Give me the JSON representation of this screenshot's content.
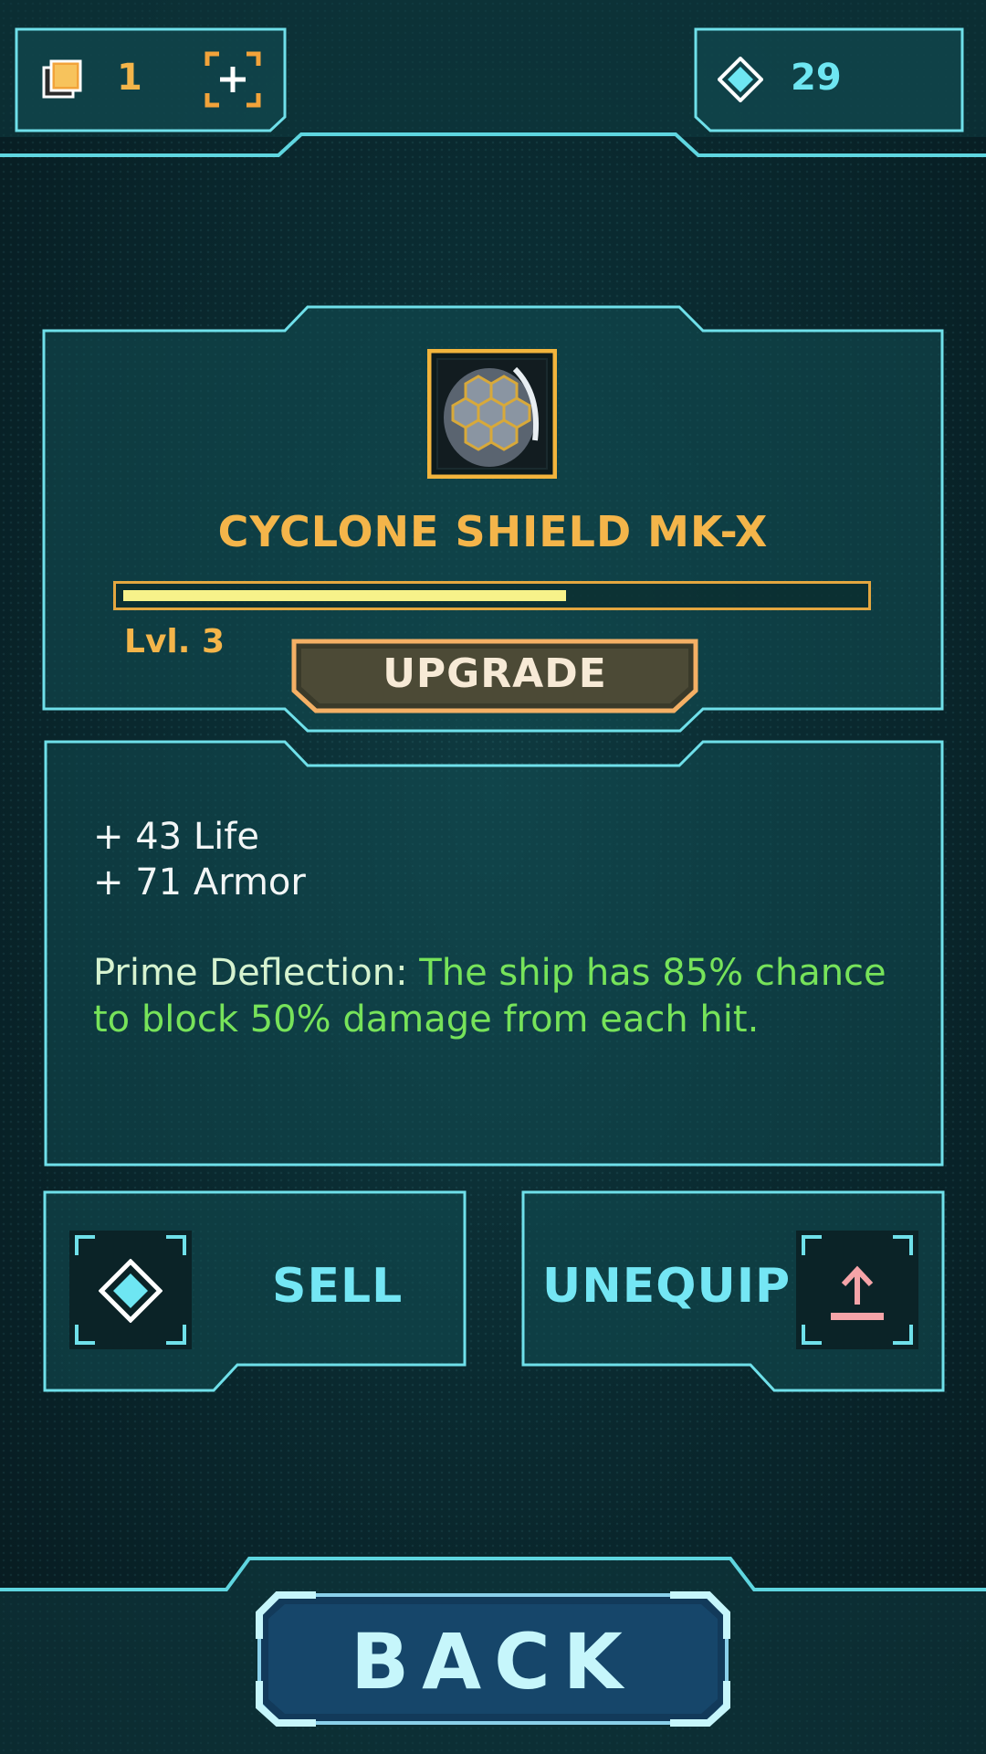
{
  "topbar": {
    "resource_icon": "stacked-cards-icon",
    "resource_count": "1",
    "add_icon": "add-bracket-icon",
    "gem_icon": "diamond-icon",
    "gem_count": "29"
  },
  "item": {
    "icon": "hex-shield-icon",
    "name": "CYCLONE SHIELD MK-X",
    "level_label": "Lvl. 3",
    "xp_progress": 0.6,
    "upgrade_label": "UPGRADE"
  },
  "stats": {
    "lines": [
      "+ 43 Life",
      "+ 71 Armor"
    ],
    "ability_name": "Prime Deflection:",
    "ability_text": " The ship has 85% chance to block 50% damage from each hit."
  },
  "actions": {
    "sell_label": "SELL",
    "sell_icon": "diamond-icon",
    "unequip_label": "UNEQUIP",
    "unequip_icon": "upload-arrow-icon"
  },
  "back_label": "BACK",
  "colors": {
    "accent_cyan": "#74e6f4",
    "accent_gold": "#f4b54a",
    "ability_green": "#77e35a",
    "unequip_pink": "#f5a4a8"
  }
}
